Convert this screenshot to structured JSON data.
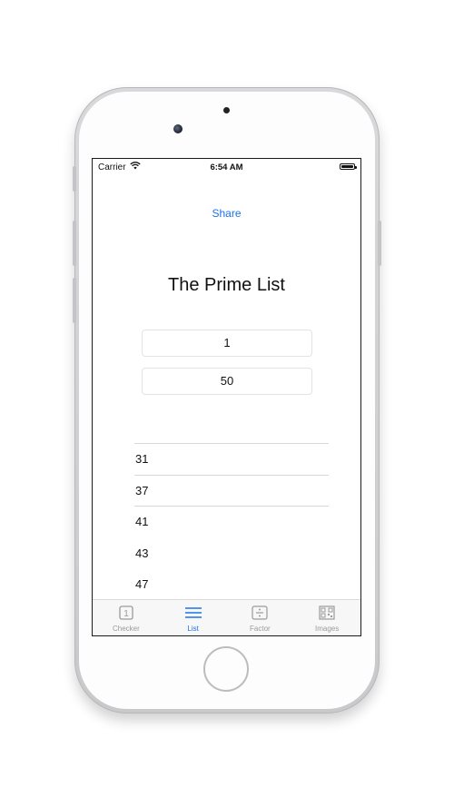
{
  "status_bar": {
    "carrier": "Carrier",
    "time": "6:54 AM"
  },
  "share_label": "Share",
  "title": "The Prime List",
  "range": {
    "from": "1",
    "to": "50"
  },
  "primes": [
    "31",
    "37",
    "41",
    "43",
    "47"
  ],
  "tabs": [
    {
      "label": "Checker",
      "icon": "number-1-icon"
    },
    {
      "label": "List",
      "icon": "list-lines-icon",
      "active": true
    },
    {
      "label": "Factor",
      "icon": "divide-icon"
    },
    {
      "label": "Images",
      "icon": "qr-image-icon"
    }
  ],
  "colors": {
    "accent": "#1a73e8",
    "inactive": "#9a9a9a"
  }
}
